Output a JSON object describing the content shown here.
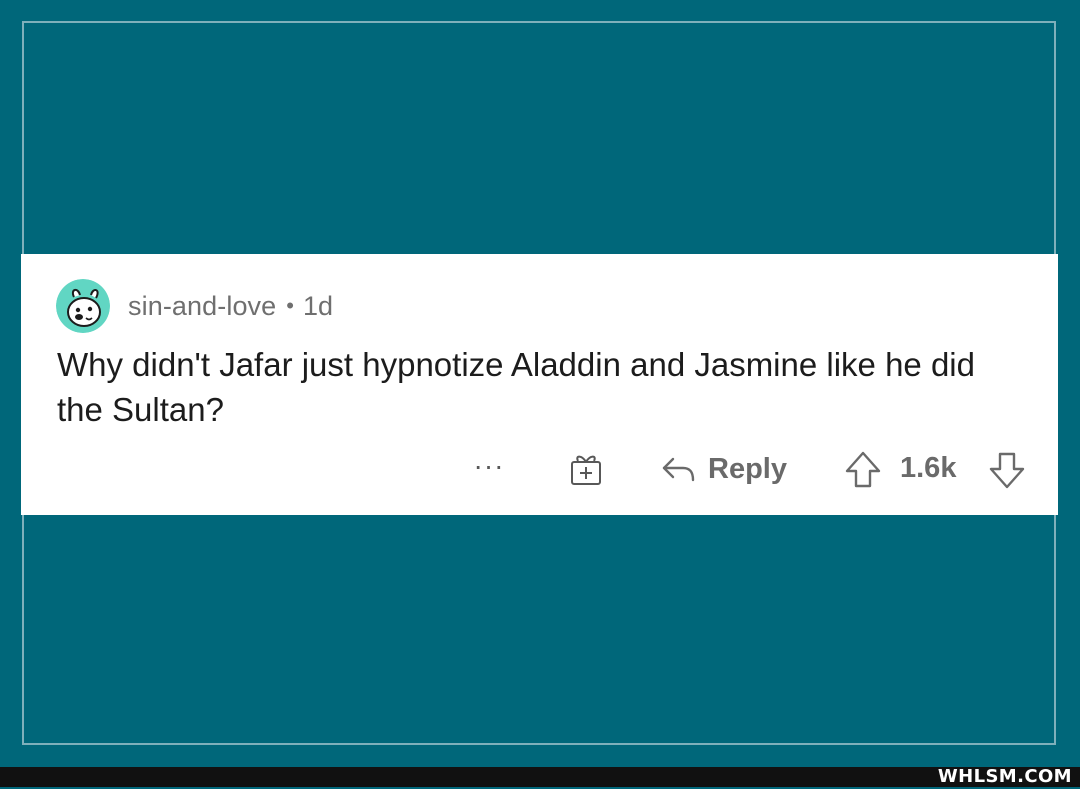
{
  "comment": {
    "username": "sin-and-love",
    "separator": "•",
    "timestamp": "1d",
    "body": "Why didn't Jafar just hypnotize Aladdin and Jasmine like he did the Sultan?",
    "avatar_icon": "snoo-avatar-icon",
    "avatar_colors": {
      "background": "#61d6c3",
      "face": "#ffffff"
    }
  },
  "actions": {
    "more_label": "···",
    "more_icon": "ellipsis-icon",
    "award_icon": "gift-award-icon",
    "reply_icon": "reply-arrow-icon",
    "reply_label": "Reply",
    "upvote_icon": "upvote-arrow-icon",
    "vote_count": "1.6k",
    "downvote_icon": "downvote-arrow-icon"
  },
  "watermark": {
    "text": "WHLSM.COM"
  },
  "colors": {
    "background": "#00677a",
    "card": "#ffffff",
    "text_primary": "#1c1c1c",
    "text_secondary": "#6f6f6f"
  }
}
